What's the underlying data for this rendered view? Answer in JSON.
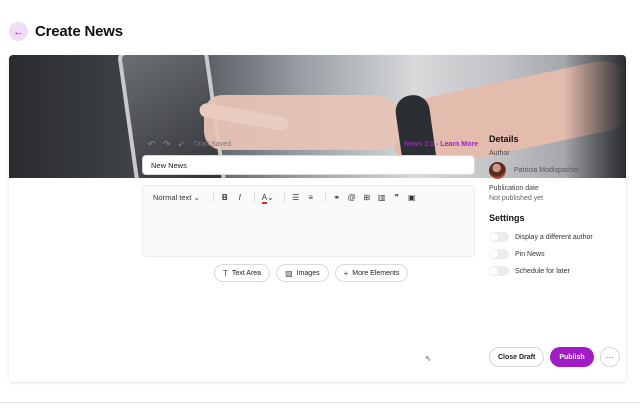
{
  "header": {
    "title": "Create News",
    "back_icon": "arrow-left-icon"
  },
  "editor": {
    "undo_icon": "undo-icon",
    "redo_icon": "redo-icon",
    "saved_icon": "check-icon",
    "status": "Draft Saved",
    "learn_more": "News 2.0 - Learn More",
    "title_value": "New News"
  },
  "toolbar": {
    "text_style": "Normal text",
    "icons": [
      "bold-icon",
      "italic-icon",
      "text-color-icon",
      "bullet-list-icon",
      "numbered-list-icon",
      "link-icon",
      "mention-icon",
      "table-icon",
      "columns-icon",
      "quote-icon",
      "embed-icon"
    ]
  },
  "add_elements": {
    "text_area": "Text Area",
    "images": "Images",
    "more": "More Elements"
  },
  "sidebar": {
    "details_heading": "Details",
    "author_label": "Author",
    "author_name": "Patricia Modispacher",
    "pub_label": "Publication date",
    "pub_value": "Not published yet",
    "settings_heading": "Settings",
    "settings": [
      {
        "label": "Display a different author",
        "enabled": false
      },
      {
        "label": "Pin News",
        "enabled": false
      },
      {
        "label": "Schedule for later",
        "enabled": false
      }
    ]
  },
  "actions": {
    "close": "Close Draft",
    "publish": "Publish",
    "more": "···"
  },
  "colors": {
    "accent": "#a21cc6",
    "accent_light": "#f1dcf5"
  }
}
